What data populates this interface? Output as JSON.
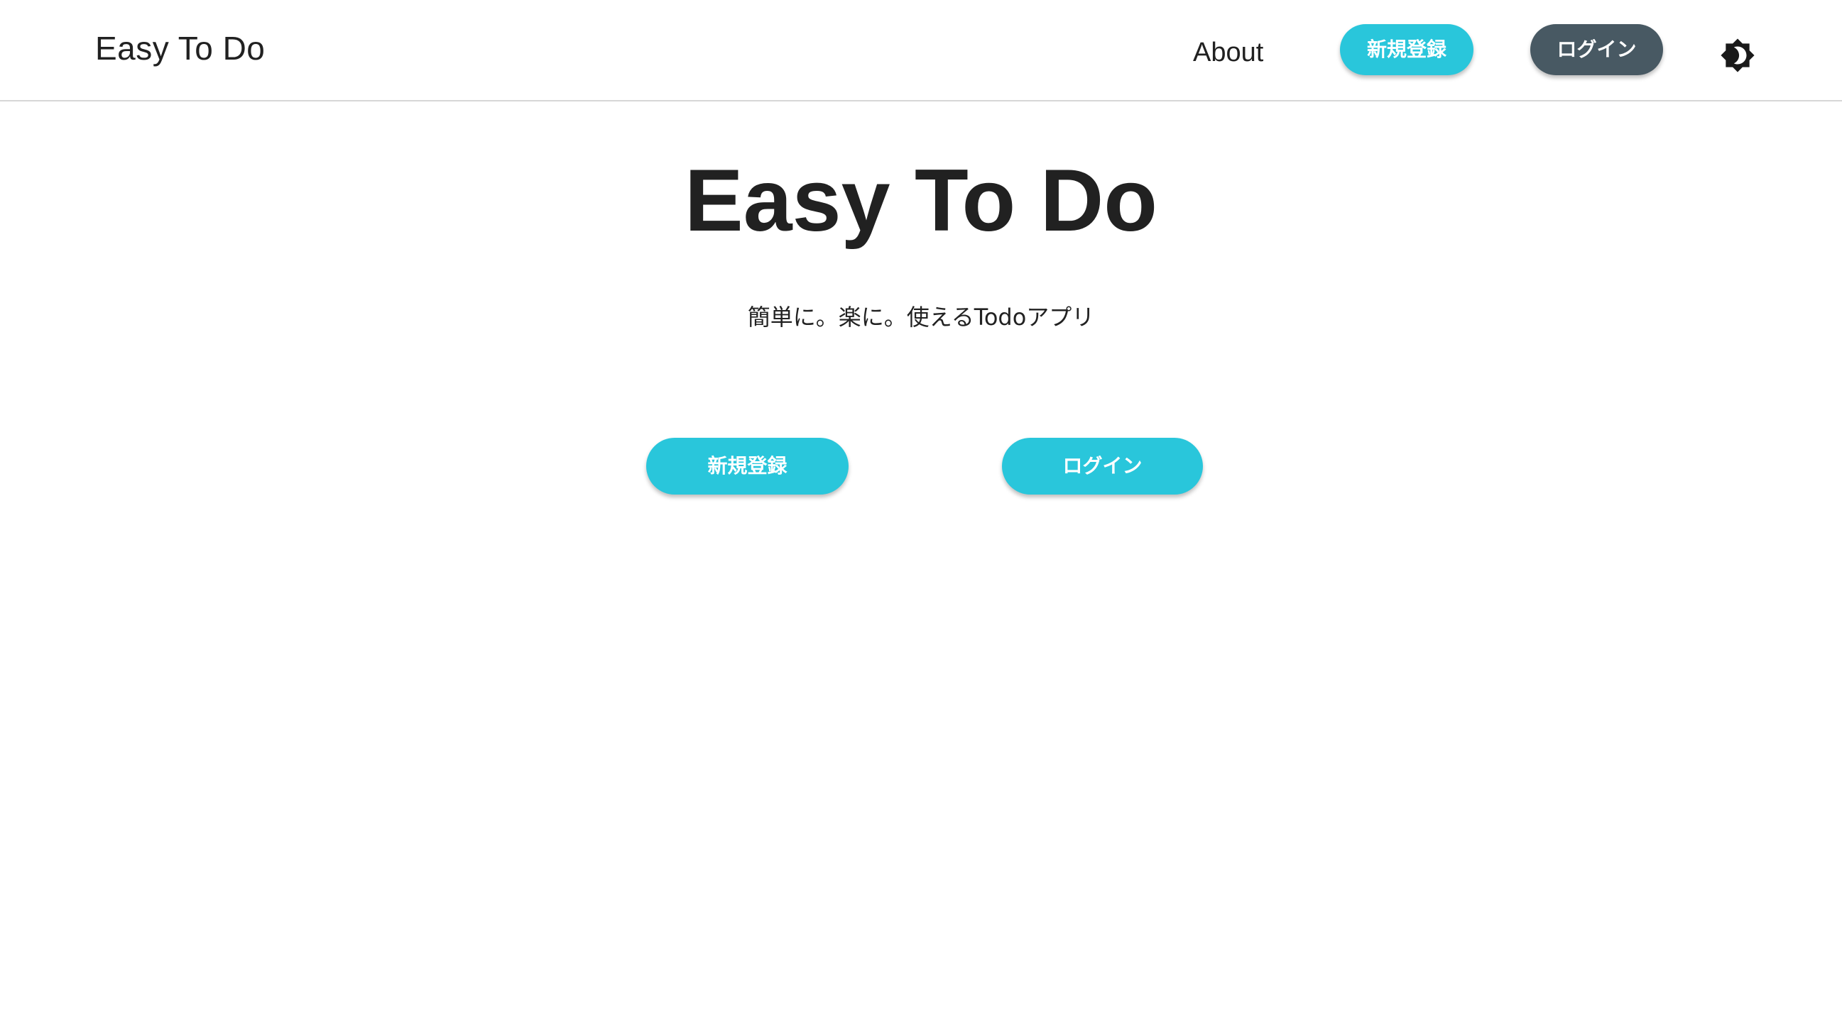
{
  "header": {
    "brand": "Easy To Do",
    "nav": {
      "about_label": "About",
      "signup_label": "新規登録",
      "login_label": "ログイン",
      "theme_toggle_icon": "brightness-icon"
    }
  },
  "hero": {
    "title": "Easy To Do",
    "subtitle": "簡単に。楽に。使えるTodoアプリ",
    "signup_label": "新規登録",
    "login_label": "ログイン"
  },
  "colors": {
    "accent": "#29c6db",
    "dark_button": "#485963",
    "text": "#212121",
    "divider": "#d6d6d6"
  }
}
